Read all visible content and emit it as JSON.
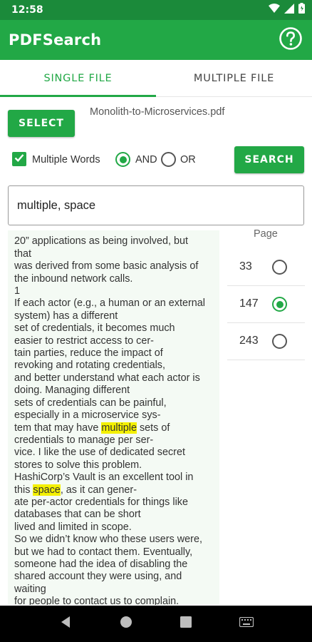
{
  "status_bar": {
    "time": "12:58"
  },
  "app_bar": {
    "title": "PDFSearch"
  },
  "tabs": [
    {
      "label": "SINGLE FILE",
      "active": true
    },
    {
      "label": "MULTIPLE FILE",
      "active": false
    }
  ],
  "controls": {
    "select_label": "SELECT",
    "file_name": "Monolith-to-Microservices.pdf",
    "multiple_words_label": "Multiple Words",
    "multiple_words_checked": true,
    "and_label": "AND",
    "or_label": "OR",
    "selected_mode": "AND",
    "search_label": "SEARCH"
  },
  "search": {
    "value": "multiple, space"
  },
  "results": {
    "page_header": "Page",
    "pages": [
      {
        "page": "33",
        "selected": false
      },
      {
        "page": "147",
        "selected": true
      },
      {
        "page": "243",
        "selected": false
      }
    ]
  },
  "text_view": {
    "top_fragment": "-",
    "before_hl1": "20” applications as being involved, but\nthat\nwas derived from some basic analysis of\nthe inbound network calls.\n1\nIf each actor (e.g., a human or an external\nsystem) has a different\nset of credentials, it becomes much\neasier to restrict access to cer-\ntain parties, reduce the impact of\nrevoking and rotating credentials,\nand better understand what each actor is\ndoing. Managing different\nsets of credentials can be painful,\nespecially in a microservice sys-\ntem that may have ",
    "hl1": "multiple",
    "between": " sets of\ncredentials to manage per ser-\nvice. I like the use of dedicated secret\nstores to solve this problem.\nHashiCorp’s Vault is an excellent tool in\nthis ",
    "hl2": "space",
    "after_hl2": ", as it can gener-\nate per-actor credentials for things like\ndatabases that can be short\nlived and limited in scope.\nSo we didn’t know who these users were,\nbut we had to contact them. Eventually,\nsomeone had the idea of disabling the\nshared account they were using, and\nwaiting\nfor people to contact us to complain."
  },
  "colors": {
    "primary": "#22a846",
    "status_bar": "#1b8a3a",
    "highlight": "#f4f000",
    "text_panel_bg": "#f4faf4"
  },
  "icons": [
    "wifi-icon",
    "signal-icon",
    "battery-icon",
    "help-icon",
    "check-icon",
    "nav-back-icon",
    "nav-home-icon",
    "nav-recents-icon",
    "keyboard-icon"
  ]
}
